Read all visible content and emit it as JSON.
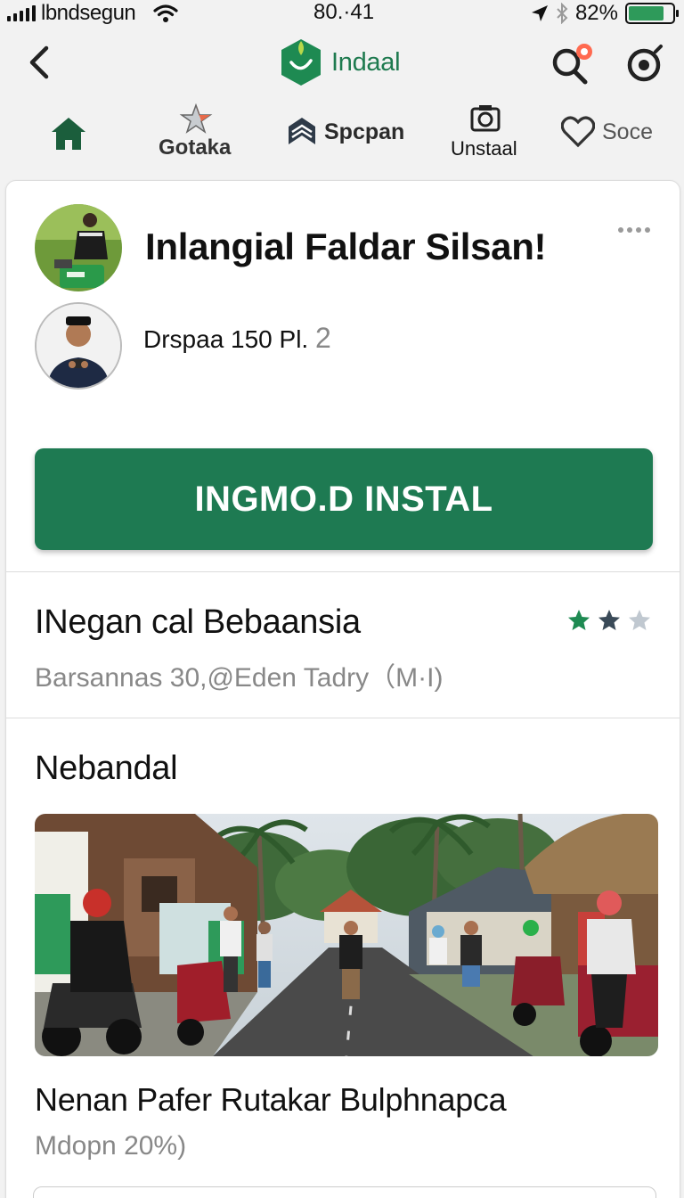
{
  "status_bar": {
    "carrier": "lbndsegun",
    "time": "80.·41",
    "battery_percent": "82%",
    "battery_level": 0.82
  },
  "nav": {
    "brand_title": "Indaal",
    "accent_color": "#1e7a52"
  },
  "tabs": [
    {
      "label": "",
      "icon": "home-icon"
    },
    {
      "label": "Gotaka",
      "icon": "star-logo-icon"
    },
    {
      "label": "Spcpan",
      "icon": "layers-icon"
    },
    {
      "label": "Unstaal",
      "icon": "camera-icon"
    },
    {
      "label": "Soce",
      "icon": "heart-icon"
    }
  ],
  "post": {
    "title": "Inlangial Faldar Silsan!",
    "subtitle": "Drspaa 150 Pl.",
    "subtitle_count": "2"
  },
  "install_button": {
    "label": "INGMO.D INSTAL"
  },
  "info_section": {
    "heading": "INegan cal Bebaansia",
    "meta": "Barsannas 30,@Eden Tadry（M·I)",
    "rating": {
      "value": 2,
      "max": 3
    }
  },
  "gallery_section": {
    "heading": "Nebandal",
    "caption_title": "Nenan Pafer Rutakar Bulphnapca",
    "caption_meta": "Mdopn 20%)"
  }
}
